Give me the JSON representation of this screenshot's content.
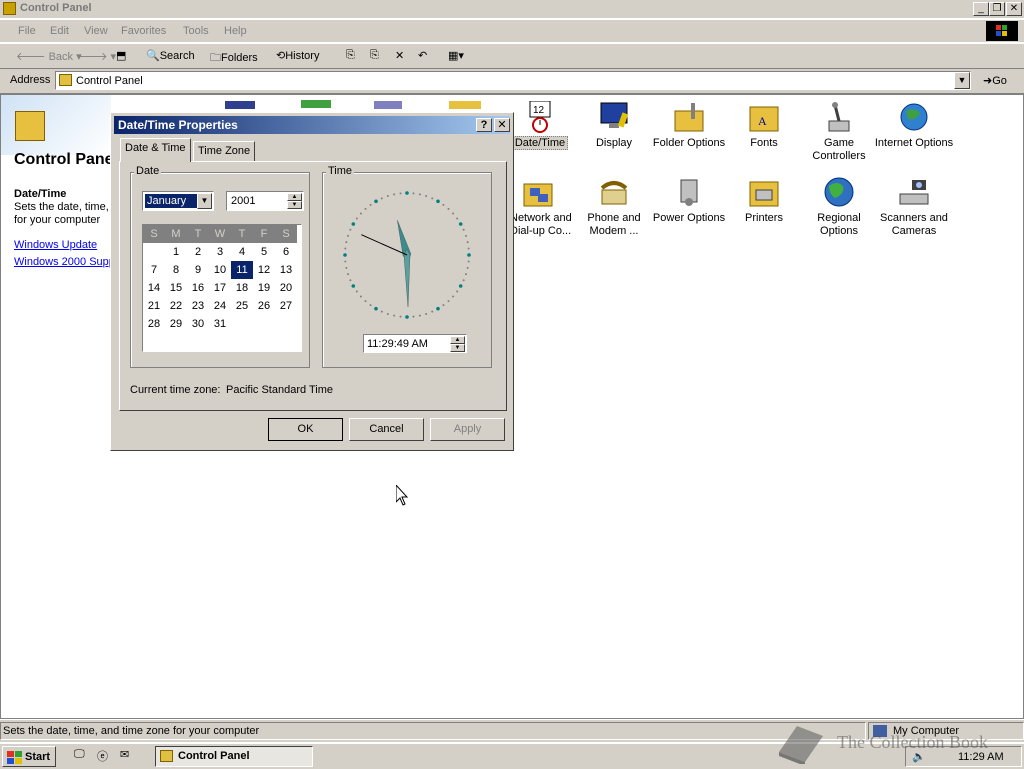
{
  "window": {
    "title": "Control Panel"
  },
  "menu": [
    "File",
    "Edit",
    "View",
    "Favorites",
    "Tools",
    "Help"
  ],
  "toolbar": {
    "back": "Back",
    "search": "Search",
    "folders": "Folders",
    "history": "History"
  },
  "address": {
    "label": "Address",
    "value": "Control Panel",
    "go": "Go"
  },
  "left_panel": {
    "title": "Control Panel",
    "item_title": "Date/Time",
    "desc_lines": [
      "Sets the date, time,",
      "for your computer"
    ],
    "links": [
      "Windows Update",
      "Windows 2000 Supp"
    ]
  },
  "items": [
    {
      "label": "Date/Time"
    },
    {
      "label": "Display"
    },
    {
      "label": "Folder Options"
    },
    {
      "label": "Fonts"
    },
    {
      "label": "Game Controllers"
    },
    {
      "label": "Internet Options"
    },
    {
      "label": "Network and Dial-up Co..."
    },
    {
      "label": "Phone and Modem ..."
    },
    {
      "label": "Power Options"
    },
    {
      "label": "Printers"
    },
    {
      "label": "Regional Options"
    },
    {
      "label": "Scanners and Cameras"
    }
  ],
  "dialog": {
    "title": "Date/Time Properties",
    "tabs": [
      "Date & Time",
      "Time Zone"
    ],
    "date_group": "Date",
    "time_group": "Time",
    "month": "January",
    "year": "2001",
    "weekdays": [
      "S",
      "M",
      "T",
      "W",
      "T",
      "F",
      "S"
    ],
    "weeks": [
      [
        "",
        "1",
        "2",
        "3",
        "4",
        "5",
        "6"
      ],
      [
        "7",
        "8",
        "9",
        "10",
        "11",
        "12",
        "13"
      ],
      [
        "14",
        "15",
        "16",
        "17",
        "18",
        "19",
        "20"
      ],
      [
        "21",
        "22",
        "23",
        "24",
        "25",
        "26",
        "27"
      ],
      [
        "28",
        "29",
        "30",
        "31",
        "",
        "",
        ""
      ]
    ],
    "selected_day": "11",
    "time_value": "11:29:49 AM",
    "timezone_label": "Current time zone:",
    "timezone": "Pacific Standard Time",
    "ok": "OK",
    "cancel": "Cancel",
    "apply": "Apply"
  },
  "statusbar": {
    "text": "Sets the date, time, and time zone for your computer",
    "zone": "My Computer"
  },
  "taskbar": {
    "start": "Start",
    "task": "Control Panel",
    "clock": "11:29 AM"
  },
  "watermark": "The Collection Book"
}
